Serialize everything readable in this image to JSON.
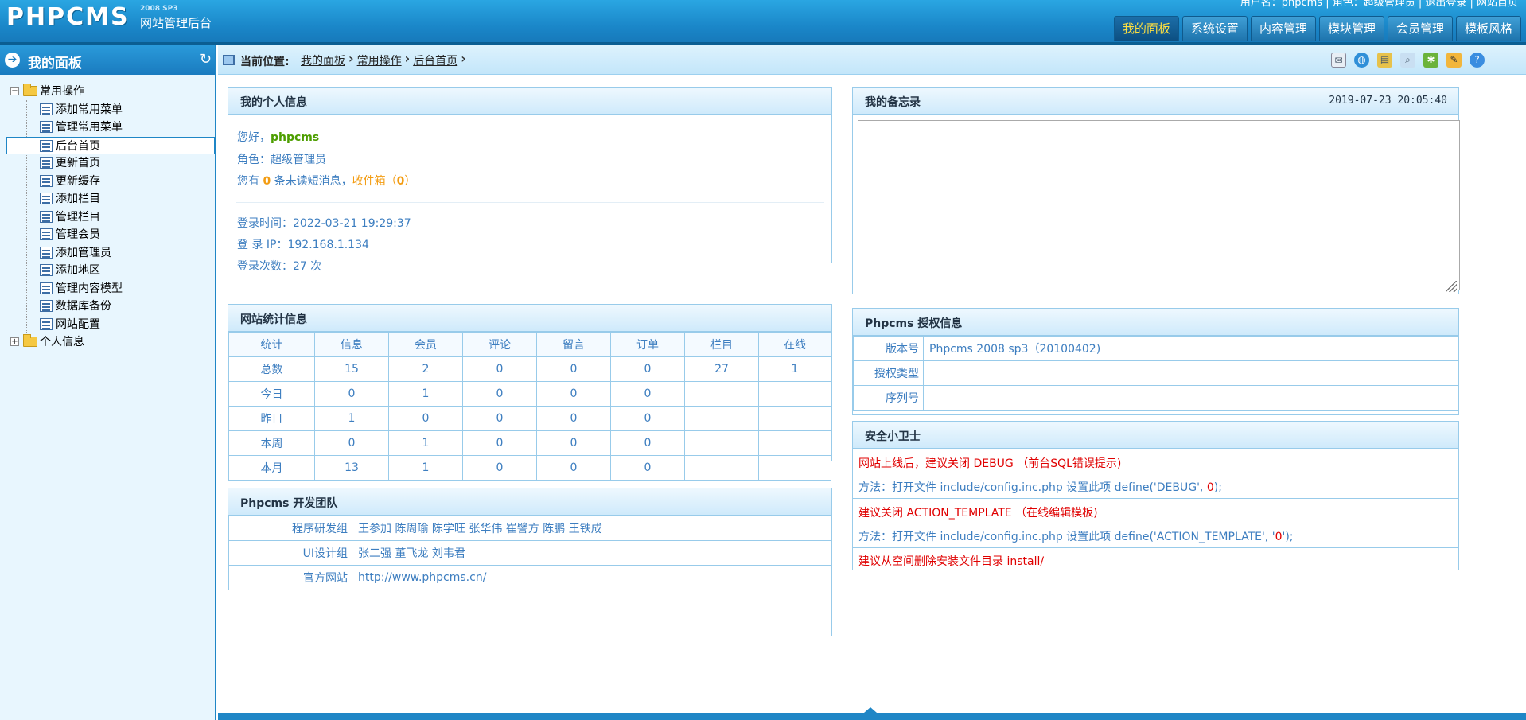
{
  "header": {
    "logo": "PHPCMS",
    "edition": "2008 SP3",
    "subtitle": "网站管理后台",
    "user_info": "用户名：phpcms | 角色：超级管理员 | 退出登录 | 网站首页",
    "tabs": [
      {
        "label": "我的面板",
        "active": true
      },
      {
        "label": "系统设置",
        "active": false
      },
      {
        "label": "内容管理",
        "active": false
      },
      {
        "label": "模块管理",
        "active": false
      },
      {
        "label": "会员管理",
        "active": false
      },
      {
        "label": "模板风格",
        "active": false
      }
    ]
  },
  "sidebar": {
    "title": "我的面板",
    "groups": [
      {
        "label": "常用操作",
        "expanded": true,
        "items": [
          "添加常用菜单",
          "管理常用菜单",
          "后台首页",
          "更新首页",
          "更新缓存",
          "添加栏目",
          "管理栏目",
          "管理会员",
          "添加管理员",
          "添加地区",
          "管理内容模型",
          "数据库备份",
          "网站配置"
        ]
      },
      {
        "label": "个人信息",
        "expanded": false,
        "items": []
      }
    ],
    "selected_item": "后台首页"
  },
  "breadcrumb": {
    "label": "当前位置:",
    "items": [
      "我的面板",
      "常用操作",
      "后台首页"
    ]
  },
  "toolbar": {
    "icons": [
      "mail-icon",
      "globe-icon",
      "folder-icon",
      "search-icon",
      "plugin-icon",
      "notepad-icon",
      "help-icon"
    ]
  },
  "personal_info": {
    "title": "我的个人信息",
    "greeting": "您好，",
    "username": "phpcms",
    "role_label": "角色：",
    "role": "超级管理员",
    "msg_prefix": "您有",
    "unread_count": "0",
    "msg_middle": "条未读短消息，",
    "inbox_label": "收件箱（",
    "inbox_count": "0",
    "inbox_suffix": "）",
    "login_time": "登录时间：2022-03-21 19:29:37",
    "login_ip": "登 录 IP：192.168.1.134",
    "login_count": "登录次数：27 次"
  },
  "stats": {
    "title": "网站统计信息",
    "headers": [
      "统计",
      "信息",
      "会员",
      "评论",
      "留言",
      "订单",
      "栏目",
      "在线"
    ],
    "rows": [
      [
        "总数",
        "15",
        "2",
        "0",
        "0",
        "0",
        "27",
        "1"
      ],
      [
        "今日",
        "0",
        "1",
        "0",
        "0",
        "0",
        "",
        ""
      ],
      [
        "昨日",
        "1",
        "0",
        "0",
        "0",
        "0",
        "",
        ""
      ],
      [
        "本周",
        "0",
        "1",
        "0",
        "0",
        "0",
        "",
        ""
      ],
      [
        "本月",
        "13",
        "1",
        "0",
        "0",
        "0",
        "",
        ""
      ]
    ]
  },
  "team": {
    "title": "Phpcms 开发团队",
    "rows": [
      {
        "key": "程序研发组",
        "value": "王参加 陈周瑜 陈学旺 张华伟 崔譬方 陈鹏 王铁成"
      },
      {
        "key": "UI设计组",
        "value": "张二强 董飞龙 刘韦君"
      },
      {
        "key": "官方网站",
        "value": "http://www.phpcms.cn/"
      }
    ]
  },
  "memo": {
    "title": "我的备忘录",
    "datetime": "2019-07-23 20:05:40",
    "content": ""
  },
  "license": {
    "title": "Phpcms 授权信息",
    "rows": [
      {
        "key": "版本号",
        "value": "Phpcms 2008 sp3（20100402)"
      },
      {
        "key": "授权类型",
        "value": ""
      },
      {
        "key": "序列号",
        "value": ""
      }
    ]
  },
  "security": {
    "title": "安全小卫士",
    "tips": [
      {
        "warn": "网站上线后，建议关闭 DEBUG （前台SQL错误提示)",
        "method_prefix": "方法：打开文件 include/config.inc.php 设置此项 define('DEBUG', ",
        "method_value": "0",
        "method_suffix": ");"
      },
      {
        "warn": "建议关闭 ACTION_TEMPLATE （在线编辑模板)",
        "method_prefix": "方法：打开文件 include/config.inc.php 设置此项 define('ACTION_TEMPLATE', '",
        "method_value": "0",
        "method_suffix": "');"
      },
      {
        "warn": "建议从空间删除安装文件目录 install/"
      }
    ]
  },
  "colors": {
    "header_blue": "#1a86c8",
    "link_blue": "#3d7ec0",
    "warning_red": "#e00000",
    "highlight_orange": "#f39c12",
    "username_green": "#4d9e00",
    "active_tab_text": "#ffe040"
  }
}
